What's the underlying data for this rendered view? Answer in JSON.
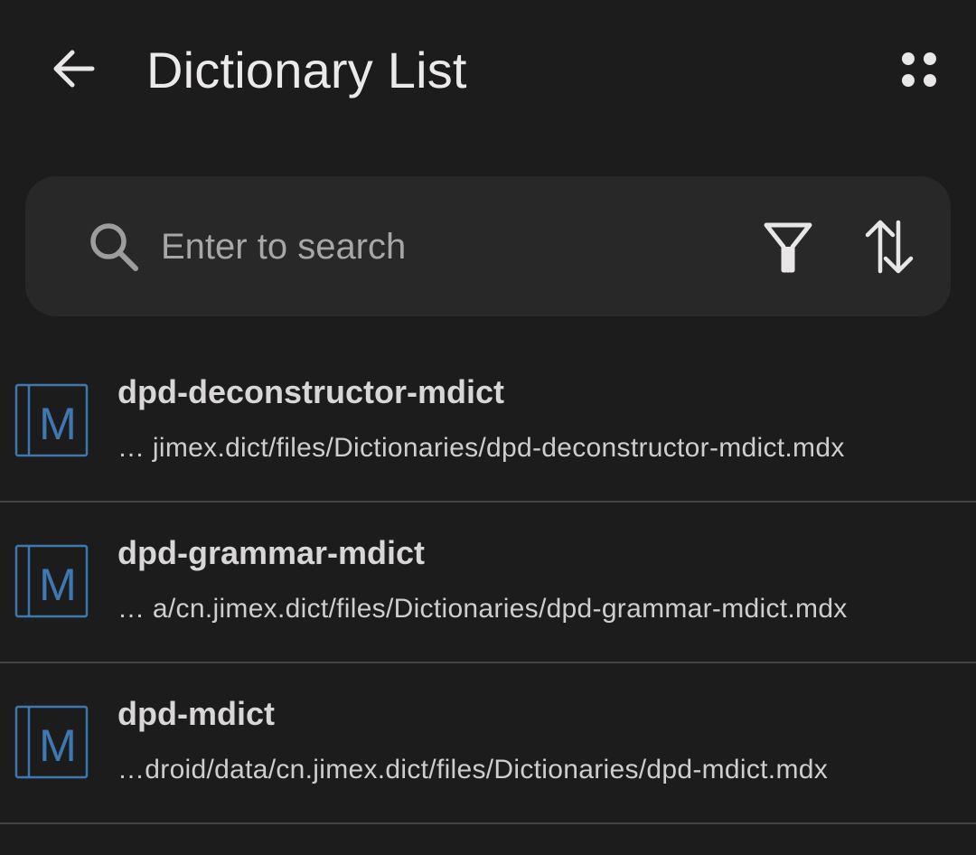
{
  "header": {
    "title": "Dictionary List",
    "back_icon": "arrow-left-icon",
    "more_icon": "four-dots-icon"
  },
  "search": {
    "placeholder": "Enter to search",
    "value": "",
    "search_icon": "search-icon",
    "filter_icon": "filter-icon",
    "sort_icon": "sort-arrows-icon"
  },
  "dictionaries": [
    {
      "name": "dpd-deconstructor-mdict",
      "path": "…  jimex.dict/files/Dictionaries/dpd-deconstructor-mdict.mdx",
      "icon": "mdict-m-icon"
    },
    {
      "name": "dpd-grammar-mdict",
      "path": "… a/cn.jimex.dict/files/Dictionaries/dpd-grammar-mdict.mdx",
      "icon": "mdict-m-icon"
    },
    {
      "name": "dpd-mdict",
      "path": "…droid/data/cn.jimex.dict/files/Dictionaries/dpd-mdict.mdx",
      "icon": "mdict-m-icon"
    }
  ],
  "colors": {
    "background": "#1b1c1b",
    "search_bg": "#272827",
    "icon_blue": "#3f78b0",
    "divider": "#424342"
  }
}
